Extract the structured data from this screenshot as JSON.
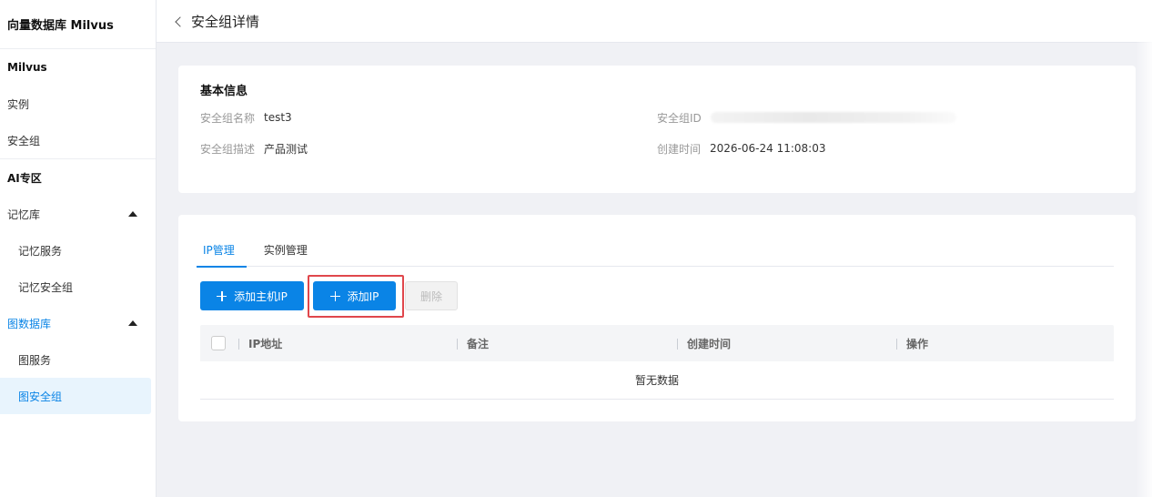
{
  "sidebar": {
    "title": "向量数据库 Milvus",
    "section1": "Milvus",
    "items1": [
      "实例",
      "安全组"
    ],
    "section2": "AI专区",
    "memory": {
      "label": "记忆库",
      "subs": [
        "记忆服务",
        "记忆安全组"
      ]
    },
    "graph": {
      "label": "图数据库",
      "subs": [
        "图服务",
        "图安全组"
      ]
    }
  },
  "header": {
    "title": "安全组详情"
  },
  "basic_info": {
    "title": "基本信息",
    "name_label": "安全组名称",
    "name_value": "test3",
    "desc_label": "安全组描述",
    "desc_value": "产品测试",
    "id_label": "安全组ID",
    "created_label": "创建时间",
    "created_value": "2026-06-24 11:08:03"
  },
  "tabs": [
    "IP管理",
    "实例管理"
  ],
  "toolbar": {
    "add_host_ip": "添加主机IP",
    "add_ip": "添加IP",
    "delete": "删除"
  },
  "table": {
    "columns": [
      "IP地址",
      "备注",
      "创建时间",
      "操作"
    ],
    "empty_text": "暂无数据"
  },
  "colors": {
    "primary": "#0a84e6",
    "highlight": "#e0474c"
  }
}
